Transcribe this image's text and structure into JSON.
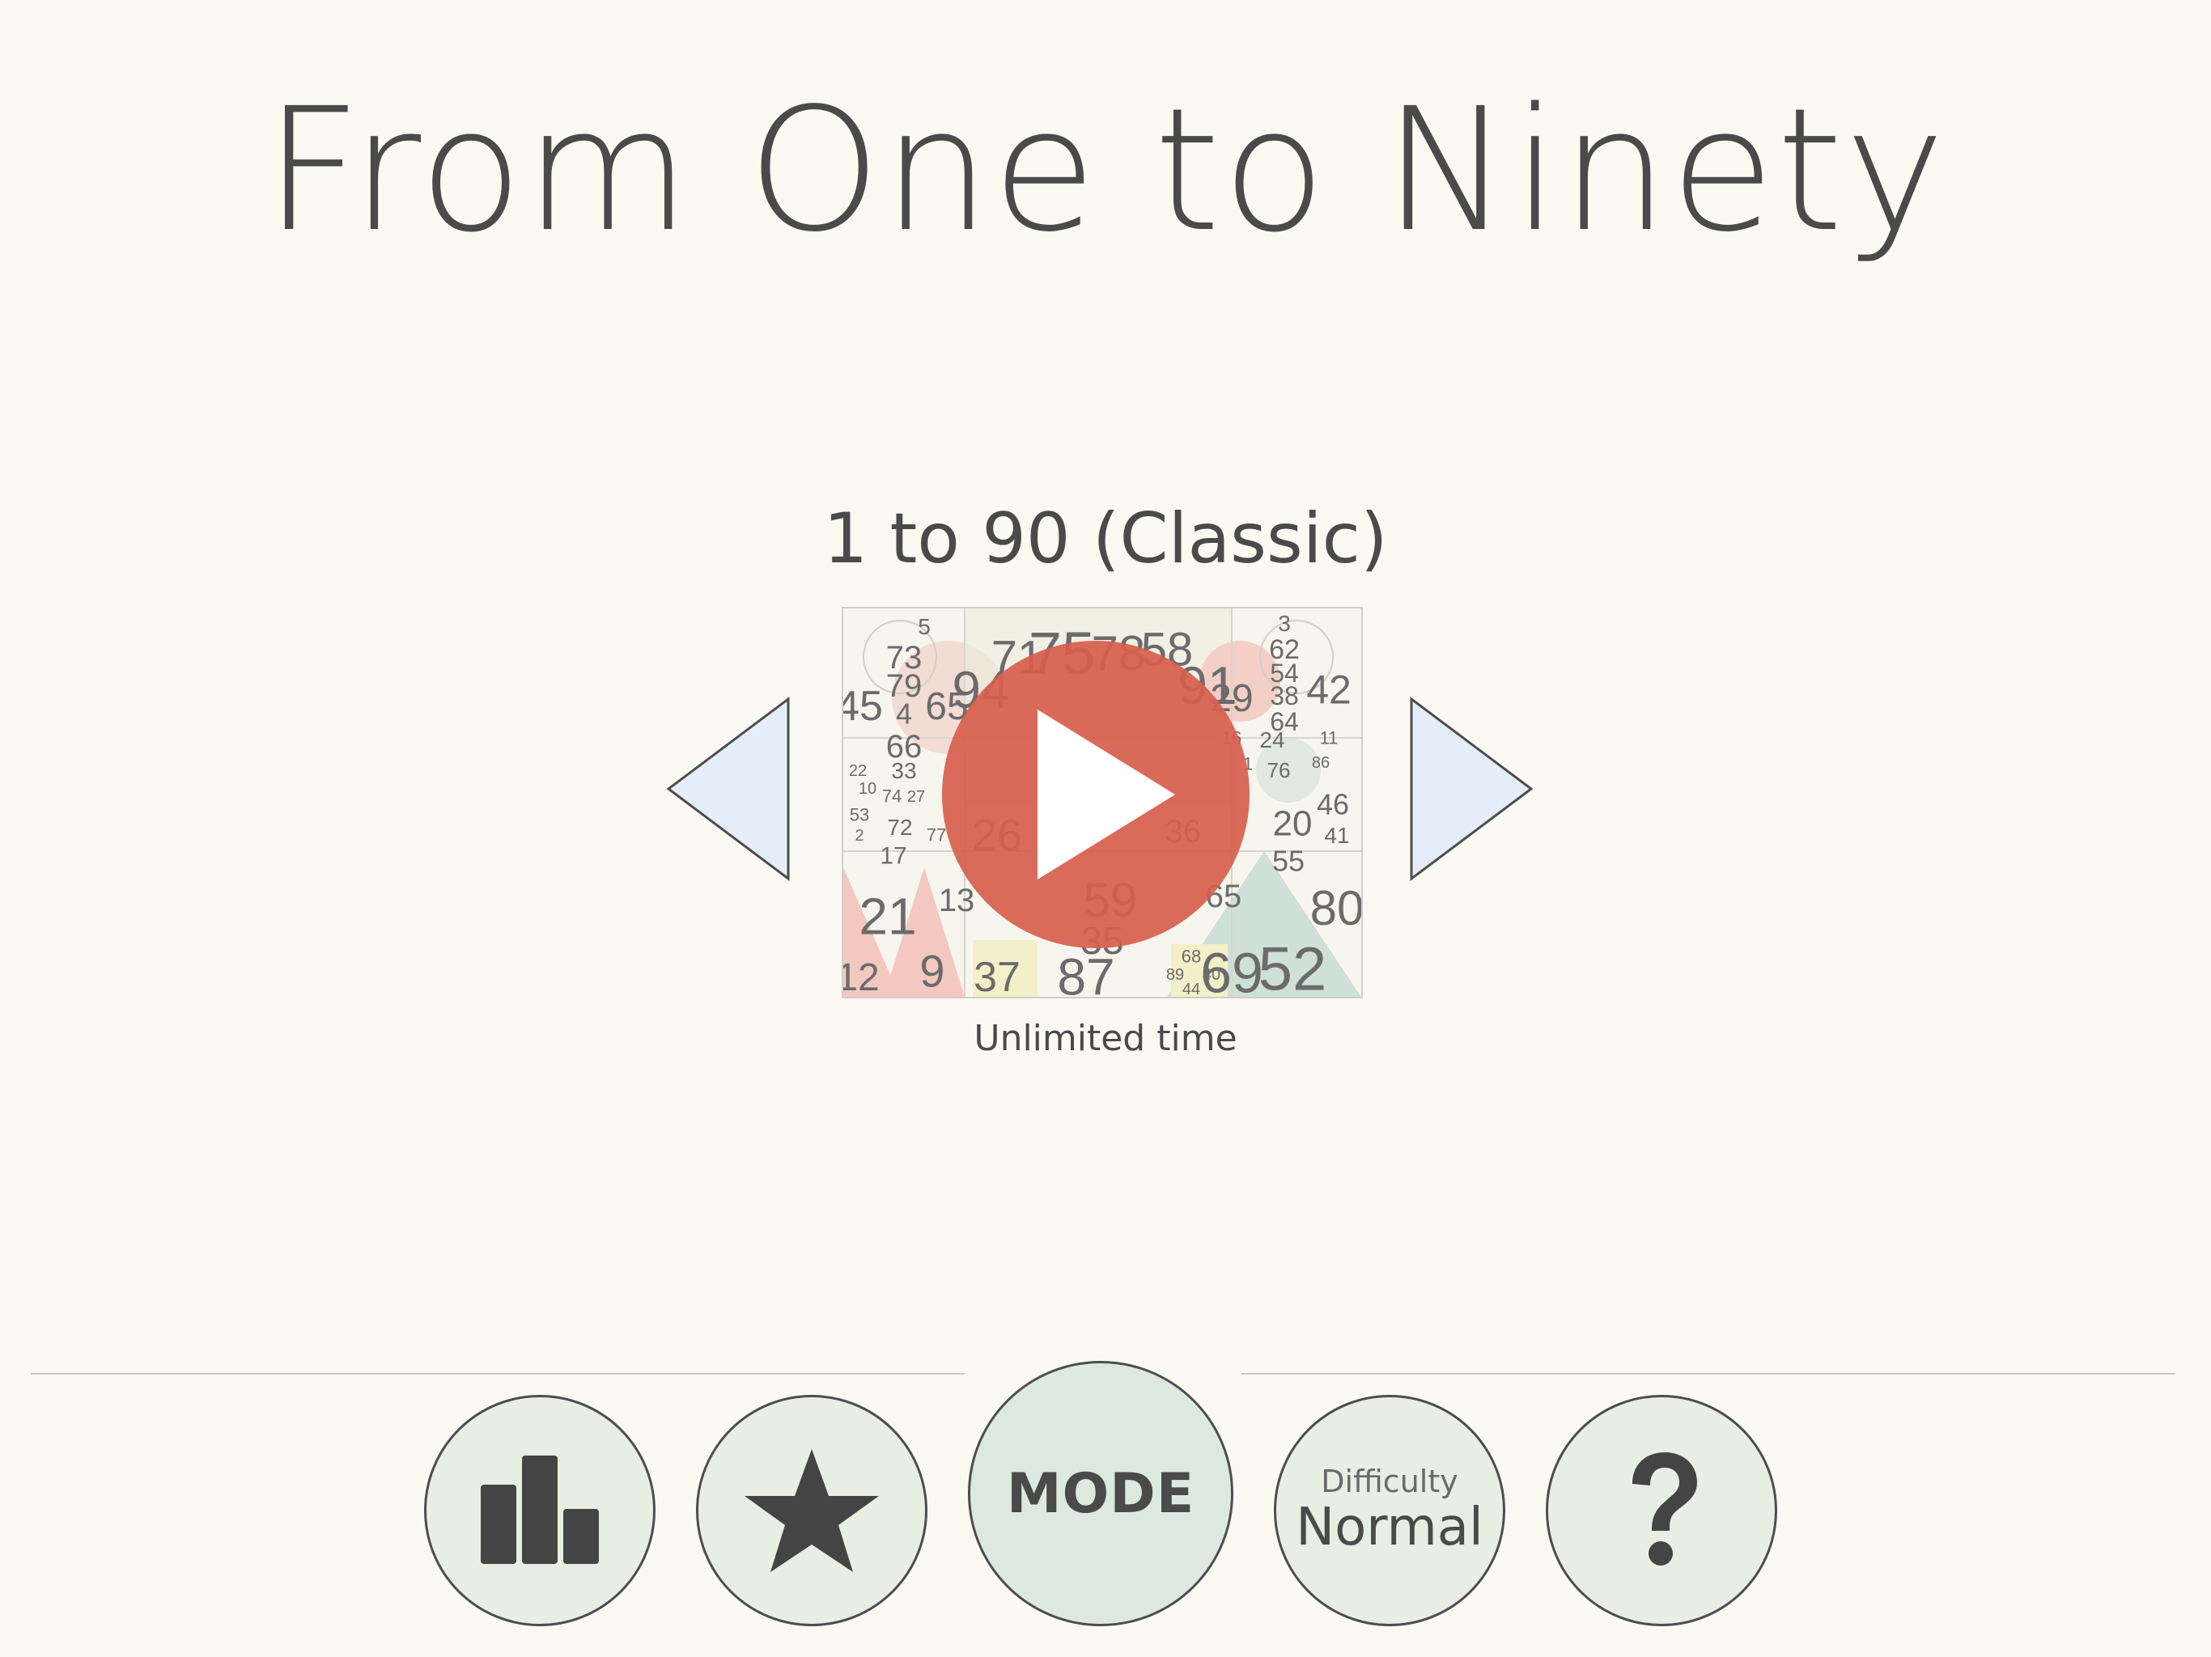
{
  "header": {
    "title": "From One to Ninety"
  },
  "mode_selector": {
    "mode_name": "1 to 90 (Classic)",
    "time_limit": "Unlimited time",
    "prev_icon": "triangle-left-icon",
    "next_icon": "triangle-right-icon",
    "play_icon": "play-icon",
    "preview_numbers": [
      "5",
      "73",
      "79",
      "4",
      "66",
      "45",
      "65",
      "94",
      "71",
      "75",
      "78",
      "58",
      "91",
      "3",
      "62",
      "54",
      "38",
      "64",
      "29",
      "42",
      "16",
      "24",
      "11",
      "1",
      "76",
      "86",
      "22",
      "33",
      "10",
      "74",
      "27",
      "53",
      "2",
      "72",
      "17",
      "77",
      "20",
      "46",
      "41",
      "55",
      "26",
      "36",
      "21",
      "13",
      "65",
      "80",
      "12",
      "9",
      "37",
      "87",
      "68",
      "89",
      "40",
      "44",
      "69",
      "52",
      "59",
      "35"
    ]
  },
  "toolbar": {
    "stats_icon": "bar-chart-icon",
    "favorites_icon": "star-icon",
    "mode_label": "MODE",
    "difficulty_caption": "Difficulty",
    "difficulty_value": "Normal",
    "help_label": "?"
  },
  "colors": {
    "background": "#fbfaf2",
    "text": "#4a4a4a",
    "play_button": "#d7604f",
    "arrow_fill": "#e4edf8",
    "button_fill": "#e8eee4",
    "mode_button_fill": "#dde8e0"
  }
}
